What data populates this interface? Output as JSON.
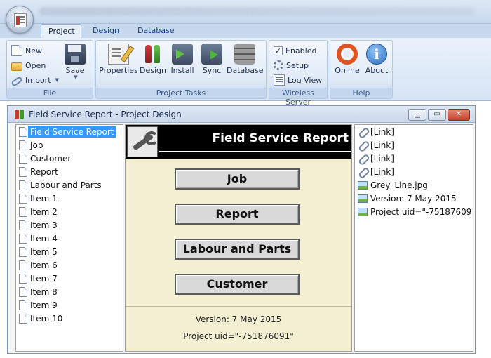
{
  "ribbon": {
    "tabs": [
      {
        "label": "Project",
        "active": true
      },
      {
        "label": "Design",
        "active": false
      },
      {
        "label": "Database",
        "active": false
      }
    ],
    "groups": {
      "file": {
        "label": "File",
        "new_label": "New",
        "open_label": "Open",
        "import_label": "Import",
        "save_label": "Save"
      },
      "project_tasks": {
        "label": "Project Tasks",
        "properties_label": "Properties",
        "design_label": "Design",
        "install_label": "Install",
        "sync_label": "Sync",
        "database_label": "Database"
      },
      "wireless_server": {
        "label": "Wireless Server",
        "enabled_label": "Enabled",
        "enabled_checked": true,
        "setup_label": "Setup",
        "logview_label": "Log View"
      },
      "help": {
        "label": "Help",
        "online_label": "Online",
        "about_label": "About"
      }
    }
  },
  "window": {
    "title": "Field Service Report - Project Design",
    "minimize_glyph": "▁",
    "maximize_glyph": "▭",
    "close_glyph": "✕"
  },
  "tree": {
    "items": [
      {
        "label": "Field Service Report",
        "selected": true
      },
      {
        "label": "Job"
      },
      {
        "label": "Customer"
      },
      {
        "label": "Report"
      },
      {
        "label": "Labour and Parts"
      },
      {
        "label": "Item 1"
      },
      {
        "label": "Item 2"
      },
      {
        "label": "Item 3"
      },
      {
        "label": "Item 4"
      },
      {
        "label": "Item 5"
      },
      {
        "label": "Item 6"
      },
      {
        "label": "Item 7"
      },
      {
        "label": "Item 8"
      },
      {
        "label": "Item 9"
      },
      {
        "label": "Item 10"
      }
    ]
  },
  "form": {
    "title": "Field Service Report",
    "buttons": [
      "Job",
      "Report",
      "Labour and Parts",
      "Customer"
    ],
    "version_text": "Version: 7 May 2015",
    "uid_text": "Project  uid=\"-751876091\""
  },
  "properties": {
    "items": [
      {
        "label": "[Link]",
        "icon": "link-icon"
      },
      {
        "label": "[Link]",
        "icon": "link-icon"
      },
      {
        "label": "[Link]",
        "icon": "link-icon"
      },
      {
        "label": "[Link]",
        "icon": "link-icon"
      },
      {
        "label": "Grey_Line.jpg",
        "icon": "image-icon"
      },
      {
        "label": "Version: 7 May 2015",
        "icon": "image-icon"
      },
      {
        "label": "Project  uid=\"-751876091...",
        "icon": "image-icon"
      }
    ]
  }
}
